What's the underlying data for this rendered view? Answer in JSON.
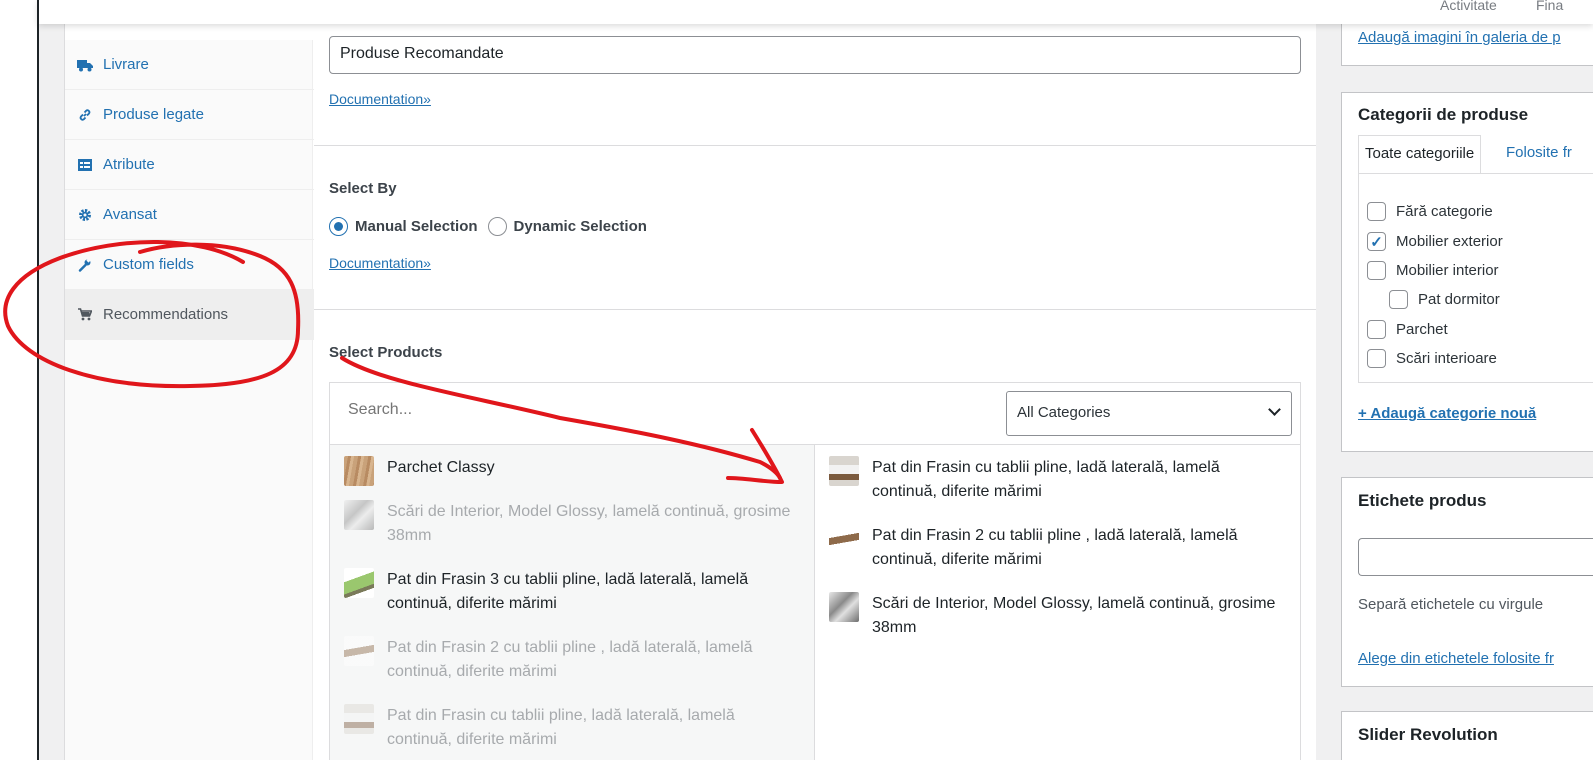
{
  "topbar": {
    "activity": "Activitate",
    "final": "Fina"
  },
  "tabs": [
    {
      "label": "Livrare",
      "icon": "truck-icon"
    },
    {
      "label": "Produse legate",
      "icon": "link-icon"
    },
    {
      "label": "Atribute",
      "icon": "list-icon"
    },
    {
      "label": "Avansat",
      "icon": "gear-icon"
    },
    {
      "label": "Custom fields",
      "icon": "wrench-icon"
    },
    {
      "label": "Recommendations",
      "icon": "cart-icon",
      "active": true
    }
  ],
  "main": {
    "title_value": "Produse Recomandate",
    "doc_link": "Documentation»",
    "select_by_label": "Select By",
    "manual_label": "Manual Selection",
    "dynamic_label": "Dynamic Selection",
    "selected_mode": "Manual Selection",
    "select_products_label": "Select Products",
    "search_placeholder": "Search...",
    "category_select": "All Categories",
    "available_products": [
      {
        "name": "Parchet Classy",
        "disabled": false
      },
      {
        "name": "Scări de Interior, Model Glossy, lamelă continuă, grosime 38mm",
        "disabled": true
      },
      {
        "name": "Pat din Frasin 3 cu tablii pline, ladă laterală, lamelă continuă, diferite mărimi",
        "disabled": false
      },
      {
        "name": "Pat din Frasin 2 cu tablii pline , ladă laterală, lamelă continuă, diferite mărimi",
        "disabled": true
      },
      {
        "name": "Pat din Frasin cu tablii pline, ladă laterală, lamelă continuă, diferite mărimi",
        "disabled": true
      }
    ],
    "selected_products": [
      {
        "name": "Pat din Frasin cu tablii pline, ladă laterală, lamelă continuă, diferite mărimi"
      },
      {
        "name": "Pat din Frasin 2 cu tablii pline , ladă laterală, lamelă continuă, diferite mărimi"
      },
      {
        "name": "Scări de Interior, Model Glossy, lamelă continuă, grosime 38mm"
      }
    ]
  },
  "sidebar": {
    "gallery_link": "Adaugă imagini în galeria de p",
    "categories": {
      "title": "Categorii de produse",
      "tab_all": "Toate categoriile",
      "tab_used": "Folosite fr",
      "items": [
        {
          "label": "Fără categorie",
          "checked": false,
          "child": false
        },
        {
          "label": "Mobilier exterior",
          "checked": true,
          "child": false
        },
        {
          "label": "Mobilier interior",
          "checked": false,
          "child": false
        },
        {
          "label": "Pat dormitor",
          "checked": false,
          "child": true
        },
        {
          "label": "Parchet",
          "checked": false,
          "child": false
        },
        {
          "label": "Scări interioare",
          "checked": false,
          "child": false
        }
      ],
      "add_link": "+ Adaugă categorie nouă"
    },
    "tags": {
      "title": "Etichete produs",
      "hint": "Separă etichetele cu virgule",
      "choose_link": "Alege din etichetele folosite fr"
    },
    "slider": {
      "title": "Slider Revolution"
    }
  },
  "colors": {
    "accent": "#2271b1",
    "annotation": "#e0161b"
  }
}
